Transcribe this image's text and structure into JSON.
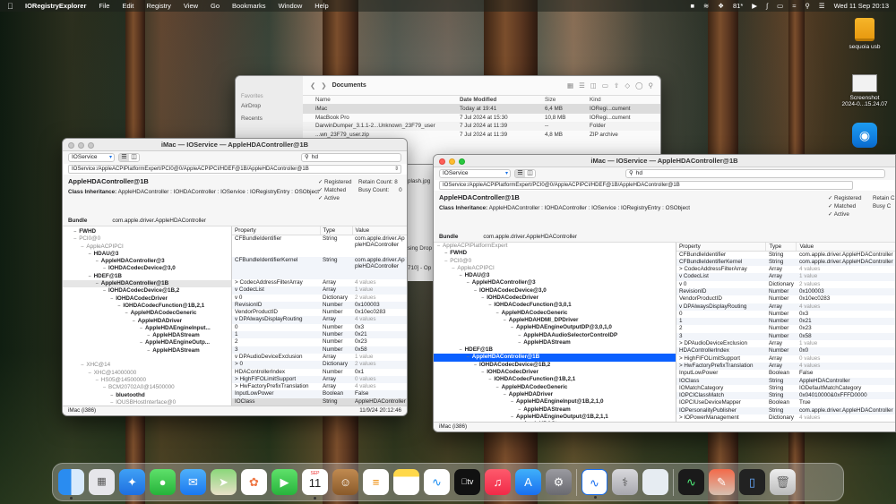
{
  "menubar": {
    "app": "IORegistryExplorer",
    "items": [
      "File",
      "Edit",
      "Registry",
      "View",
      "Go",
      "Bookmarks",
      "Window",
      "Help"
    ],
    "battery": "81*",
    "datetime": "Wed 11 Sep  20:13"
  },
  "desktop": {
    "drive_label": "sequoia usb",
    "screenshot_label_1": "Screenshot",
    "screenshot_label_2": "2024-0...15.24.07"
  },
  "finder": {
    "title": "Documents",
    "sidebar": [
      "Favorites",
      "AirDrop",
      "Recents"
    ],
    "columns": [
      "Name",
      "Date Modified",
      "Size",
      "Kind"
    ],
    "rows": [
      {
        "name": "iMac",
        "date": "Today at 19:41",
        "size": "6,4 MB",
        "kind": "IORegi...cument"
      },
      {
        "name": "MacBook Pro",
        "date": "7 Jul 2024 at 15:30",
        "size": "10,8 MB",
        "kind": "IORegi...cument"
      },
      {
        "name": "DarwinDumper_3.1.1-2...Unknown_23F79_user",
        "date": "7 Jul 2024 at 11:39",
        "size": "--",
        "kind": "Folder"
      },
      {
        "name": "...wn_23F79_user.zip",
        "date": "7 Jul 2024 at 11:39",
        "size": "4,8 MB",
        "kind": "ZIP archive"
      }
    ],
    "fragments": [
      "plash.jpg",
      "sing Drop",
      "710] - Op"
    ]
  },
  "left_window": {
    "title": "iMac — IOService — AppleHDAController@1B",
    "plane": "IOService",
    "search": "hd",
    "path": "IOService:/AppleACPIPlatformExpert/PCI0@0/AppleACPIPCI/HDEF@1B/AppleHDAController@1B",
    "class_name": "AppleHDAController@1B",
    "inheritance_label": "Class Inheritance:",
    "inheritance": "AppleHDAController : IOHDAController : IOService : IORegistryEntry : OSObject",
    "flags": [
      "Registered",
      "Matched",
      "Active"
    ],
    "retain_label": "Retain Count:",
    "retain": "8",
    "busy_label": "Busy Count:",
    "busy": "0",
    "bundle_label": "Bundle",
    "bundle": "com.apple.driver.AppleHDAController",
    "tree": [
      {
        "t": "FWHD",
        "lvl": 1,
        "b": true
      },
      {
        "t": "PCI0@0",
        "lvl": 1,
        "b": false,
        "g": true
      },
      {
        "t": "AppleACPIPCI",
        "lvl": 2,
        "b": false,
        "g": true
      },
      {
        "t": "HDAU@3",
        "lvl": 3,
        "b": true
      },
      {
        "t": "AppleHDAController@3",
        "lvl": 4,
        "b": true
      },
      {
        "t": "IOHDACodecDevice@3,0",
        "lvl": 5,
        "b": true
      },
      {
        "t": "HDEF@1B",
        "lvl": 3,
        "b": true
      },
      {
        "t": "AppleHDAController@1B",
        "lvl": 4,
        "b": true,
        "hl": true
      },
      {
        "t": "IOHDACodecDevice@1B,2",
        "lvl": 5,
        "b": true
      },
      {
        "t": "IOHDACodecDriver",
        "lvl": 6,
        "b": true
      },
      {
        "t": "IOHDACodecFunction@1B,2,1",
        "lvl": 7,
        "b": true
      },
      {
        "t": "AppleHDACodecGeneric",
        "lvl": 8,
        "b": true
      },
      {
        "t": "AppleHDADriver",
        "lvl": 9,
        "b": true
      },
      {
        "t": "AppleHDAEngineInput...",
        "lvl": 10,
        "b": true
      },
      {
        "t": "AppleHDAStream",
        "lvl": 11,
        "b": true
      },
      {
        "t": "AppleHDAEngineOutp...",
        "lvl": 10,
        "b": true
      },
      {
        "t": "AppleHDAStream",
        "lvl": 11,
        "b": true
      },
      {
        "t": "",
        "lvl": 0,
        "b": false
      },
      {
        "t": "XHC@14",
        "lvl": 2,
        "b": false,
        "g": true
      },
      {
        "t": "XHC@14000000",
        "lvl": 3,
        "b": false,
        "g": true
      },
      {
        "t": "HS05@14500000",
        "lvl": 4,
        "b": false,
        "g": true
      },
      {
        "t": "BCM20702A0@14500000",
        "lvl": 5,
        "b": false,
        "g": true
      },
      {
        "t": "bluetoothd",
        "lvl": 6,
        "b": true
      },
      {
        "t": "IOUSBHostInterface@0",
        "lvl": 6,
        "b": false,
        "g": true
      }
    ],
    "prop_headers": [
      "Property",
      "Type",
      "Value"
    ],
    "props": [
      {
        "p": "CFBundleIdentifier",
        "ty": "String",
        "v": "com.apple.driver.AppleHDAController",
        "tall": true
      },
      {
        "p": "CFBundleIdentifierKernel",
        "ty": "String",
        "v": "com.apple.driver.AppleHDAController",
        "tall": true
      },
      {
        "p": "> CodecAddressFilterArray",
        "ty": "Array",
        "v": "4 values",
        "g": true
      },
      {
        "p": "v CodecList",
        "ty": "Array",
        "v": "1 value",
        "g": true
      },
      {
        "p": "  v 0",
        "ty": "Dictionary",
        "v": "2 values",
        "g": true
      },
      {
        "p": "        RevisionID",
        "ty": "Number",
        "v": "0x100003"
      },
      {
        "p": "        VendorProductID",
        "ty": "Number",
        "v": "0x10ec0283"
      },
      {
        "p": "v DPAlwaysDisplayRouting",
        "ty": "Array",
        "v": "4 values",
        "g": true
      },
      {
        "p": "     0",
        "ty": "Number",
        "v": "0x3"
      },
      {
        "p": "     1",
        "ty": "Number",
        "v": "0x21"
      },
      {
        "p": "     2",
        "ty": "Number",
        "v": "0x23"
      },
      {
        "p": "     3",
        "ty": "Number",
        "v": "0x58"
      },
      {
        "p": "v DPAudioDeviceExclusion",
        "ty": "Array",
        "v": "1 value",
        "g": true
      },
      {
        "p": "  > 0",
        "ty": "Dictionary",
        "v": "2 values",
        "g": true
      },
      {
        "p": "HDAControllerIndex",
        "ty": "Number",
        "v": "0x1"
      },
      {
        "p": "> HighFIFOLimitSupport",
        "ty": "Array",
        "v": "0 values",
        "g": true
      },
      {
        "p": "> HwFactoryPrefixTranslation",
        "ty": "Array",
        "v": "4 values",
        "g": true
      },
      {
        "p": "InputLowPower",
        "ty": "Boolean",
        "v": "False"
      },
      {
        "p": "IOClass",
        "ty": "String",
        "v": "AppleHDAController",
        "sel": true
      }
    ],
    "status_left": "iMac (i386)",
    "status_right": "11/9/24 20:12:46"
  },
  "right_window": {
    "title": "iMac — IOService — AppleHDAController@1B",
    "plane": "IOService",
    "search": "hd",
    "path": "IOService:/AppleACPIPlatformExpert/PCI0@0/AppleACPIPCI/HDEF@1B/AppleHDAController@1B",
    "class_name": "AppleHDAController@1B",
    "inheritance_label": "Class Inheritance:",
    "inheritance": "AppleHDAController : IOHDAController : IOService : IORegistryEntry : OSObject",
    "flags": [
      "Registered",
      "Matched",
      "Active"
    ],
    "retain_label": "Retain C",
    "busy_label": "Busy C",
    "bundle_label": "Bundle",
    "bundle": "com.apple.driver.AppleHDAController",
    "tree": [
      {
        "t": "AppleACPIPlatformExpert",
        "lvl": 0,
        "b": false,
        "g": true
      },
      {
        "t": "FWHD",
        "lvl": 1,
        "b": true
      },
      {
        "t": "PCI0@0",
        "lvl": 1,
        "b": false,
        "g": true
      },
      {
        "t": "AppleACPIPCI",
        "lvl": 2,
        "b": false,
        "g": true
      },
      {
        "t": "HDAU@3",
        "lvl": 3,
        "b": true
      },
      {
        "t": "AppleHDAController@3",
        "lvl": 4,
        "b": true
      },
      {
        "t": "IOHDACodecDevice@3,0",
        "lvl": 5,
        "b": true
      },
      {
        "t": "IOHDACodecDriver",
        "lvl": 6,
        "b": true
      },
      {
        "t": "IOHDACodecFunction@3,0,1",
        "lvl": 7,
        "b": true
      },
      {
        "t": "AppleHDACodecGeneric",
        "lvl": 8,
        "b": true
      },
      {
        "t": "AppleHDAHDMI_DPDriver",
        "lvl": 9,
        "b": true
      },
      {
        "t": "AppleHDAEngineOutputDP@3,0,1,0",
        "lvl": 10,
        "b": true
      },
      {
        "t": "AppleHDAAudioSelectorControlDP",
        "lvl": 11,
        "b": true
      },
      {
        "t": "AppleHDAStream",
        "lvl": 11,
        "b": true
      },
      {
        "t": "HDEF@1B",
        "lvl": 3,
        "b": true
      },
      {
        "t": "AppleHDAController@1B",
        "lvl": 4,
        "b": true,
        "sel": true
      },
      {
        "t": "IOHDACodecDevice@1B,2",
        "lvl": 5,
        "b": true
      },
      {
        "t": "IOHDACodecDriver",
        "lvl": 6,
        "b": true
      },
      {
        "t": "IOHDACodecFunction@1B,2,1",
        "lvl": 7,
        "b": true
      },
      {
        "t": "AppleHDACodecGeneric",
        "lvl": 8,
        "b": true
      },
      {
        "t": "AppleHDADriver",
        "lvl": 9,
        "b": true
      },
      {
        "t": "AppleHDAEngineInput@1B,2,1,0",
        "lvl": 10,
        "b": true
      },
      {
        "t": "AppleHDAStream",
        "lvl": 11,
        "b": true
      },
      {
        "t": "AppleHDAEngineOutput@1B,2,1,1",
        "lvl": 10,
        "b": true
      },
      {
        "t": "AppleHDAStream",
        "lvl": 11,
        "b": true
      }
    ],
    "prop_headers": [
      "Property",
      "Type",
      "Value"
    ],
    "props": [
      {
        "p": "CFBundleIdentifier",
        "ty": "String",
        "v": "com.apple.driver.AppleHDAController"
      },
      {
        "p": "CFBundleIdentifierKernel",
        "ty": "String",
        "v": "com.apple.driver.AppleHDAController"
      },
      {
        "p": "> CodecAddressFilterArray",
        "ty": "Array",
        "v": "4 values",
        "g": true
      },
      {
        "p": "v CodecList",
        "ty": "Array",
        "v": "1 value",
        "g": true
      },
      {
        "p": "  v 0",
        "ty": "Dictionary",
        "v": "2 values",
        "g": true
      },
      {
        "p": "        RevisionID",
        "ty": "Number",
        "v": "0x100003"
      },
      {
        "p": "        VendorProductID",
        "ty": "Number",
        "v": "0x10ec0283"
      },
      {
        "p": "v DPAlwaysDisplayRouting",
        "ty": "Array",
        "v": "4 values",
        "g": true
      },
      {
        "p": "     0",
        "ty": "Number",
        "v": "0x3"
      },
      {
        "p": "     1",
        "ty": "Number",
        "v": "0x21"
      },
      {
        "p": "     2",
        "ty": "Number",
        "v": "0x23"
      },
      {
        "p": "     3",
        "ty": "Number",
        "v": "0x58"
      },
      {
        "p": "> DPAudioDeviceExclusion",
        "ty": "Array",
        "v": "1 value",
        "g": true
      },
      {
        "p": "HDAControllerIndex",
        "ty": "Number",
        "v": "0x0"
      },
      {
        "p": "> HighFIFOLimitSupport",
        "ty": "Array",
        "v": "0 values",
        "g": true
      },
      {
        "p": "> HwFactoryPrefixTranslation",
        "ty": "Array",
        "v": "4 values",
        "g": true
      },
      {
        "p": "InputLowPower",
        "ty": "Boolean",
        "v": "False"
      },
      {
        "p": "IOClass",
        "ty": "String",
        "v": "AppleHDAController"
      },
      {
        "p": "IOMatchCategory",
        "ty": "String",
        "v": "IODefaultMatchCategory"
      },
      {
        "p": "IOPCIClassMatch",
        "ty": "String",
        "v": "0x04010000&0xFFFD0000"
      },
      {
        "p": "IOPCIUseDeviceMapper",
        "ty": "Boolean",
        "v": "True"
      },
      {
        "p": "IOPersonalityPublisher",
        "ty": "String",
        "v": "com.apple.driver.AppleHDAController"
      },
      {
        "p": "> IOPowerManagement",
        "ty": "Dictionary",
        "v": "4 values",
        "g": true
      },
      {
        "p": "IOProbeScore",
        "ty": "Number",
        "v": "0x1"
      }
    ],
    "status_left": "iMac (i386)"
  },
  "dock": {
    "calendar_month": "SEP",
    "calendar_day": "11",
    "apps": [
      "finder-icon",
      "launchpad-icon",
      "safari-icon",
      "messages-icon",
      "mail-icon",
      "maps-icon",
      "photos-icon",
      "facetime-icon",
      "calendar-icon",
      "contacts-icon",
      "reminders-icon",
      "notes-icon",
      "freeform-icon",
      "tv-icon",
      "music-icon",
      "appstore-icon",
      "settings-icon",
      "ioregistry-icon",
      "diskutility-icon",
      "preview-icon",
      "activity-icon",
      "scripts-icon",
      "iphone-mirror-icon",
      "trash-icon"
    ]
  }
}
